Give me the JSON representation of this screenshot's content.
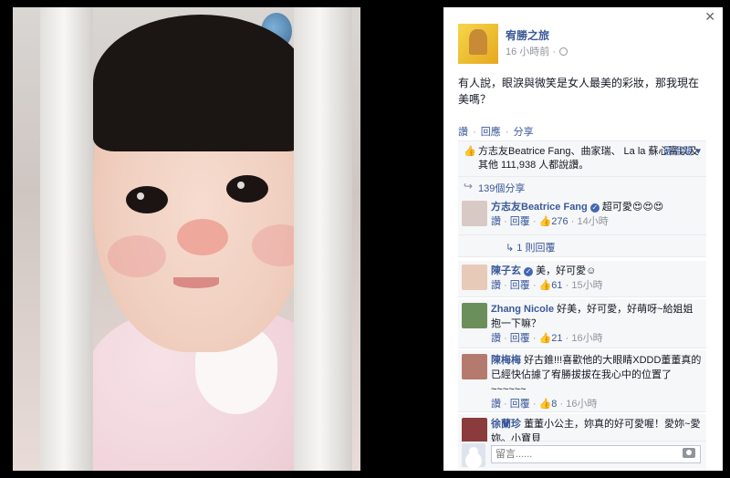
{
  "post": {
    "page_name": "宥勝之旅",
    "time": "16 小時前 ·",
    "text": "有人說，眼淚與微笑是女人最美的彩妝，那我現在美嗎？",
    "actions": {
      "like": "讚",
      "comment": "回應",
      "share": "分享"
    }
  },
  "likes": {
    "names": "方志友Beatrice Fang、曲家瑞、 La la 蘇心甯以及其他 111,938 人都說讚。",
    "most_relevant": "最相關 ▾",
    "shares": "139個分享"
  },
  "comments": [
    {
      "name": "方志友Beatrice Fang",
      "verified": true,
      "text": "超可愛😍😍😍",
      "like": "讚",
      "reply": "回覆",
      "likes": "276",
      "time": "14小時",
      "avatar_color": "#d9c9c4"
    },
    {
      "name": "陳子玄",
      "verified": true,
      "text": "美，好可愛☺",
      "like": "讚",
      "reply": "回覆",
      "likes": "61",
      "time": "15小時",
      "avatar_color": "#e7cbb8"
    },
    {
      "name": "Zhang Nicole",
      "verified": false,
      "text": "好美，好可愛，好萌呀~給姐姐抱一下嘛？",
      "like": "讚",
      "reply": "回覆",
      "likes": "21",
      "time": "16小時",
      "avatar_color": "#6b8f5b"
    },
    {
      "name": "陳梅梅",
      "verified": false,
      "text": "好古錐!!!喜歡他的大眼睛XDDD董董真的已經快佔據了宥勝拔拔在我心中的位置了~~~~~~",
      "like": "讚",
      "reply": "回覆",
      "likes": "8",
      "time": "16小時",
      "avatar_color": "#b57a6e"
    },
    {
      "name": "徐蘭珍",
      "verified": false,
      "text": "董董小公主，妳真的好可愛喔！愛妳~愛妳。小寶貝",
      "avatar_color": "#8b3b3b"
    }
  ],
  "reply_link": "↳ 1 則回覆",
  "comment_placeholder": "留言......",
  "icons": {
    "close": "✕",
    "like": "thumbs-up-icon",
    "share": "share-arrow-icon",
    "camera": "camera-icon",
    "globe": "globe-icon"
  }
}
